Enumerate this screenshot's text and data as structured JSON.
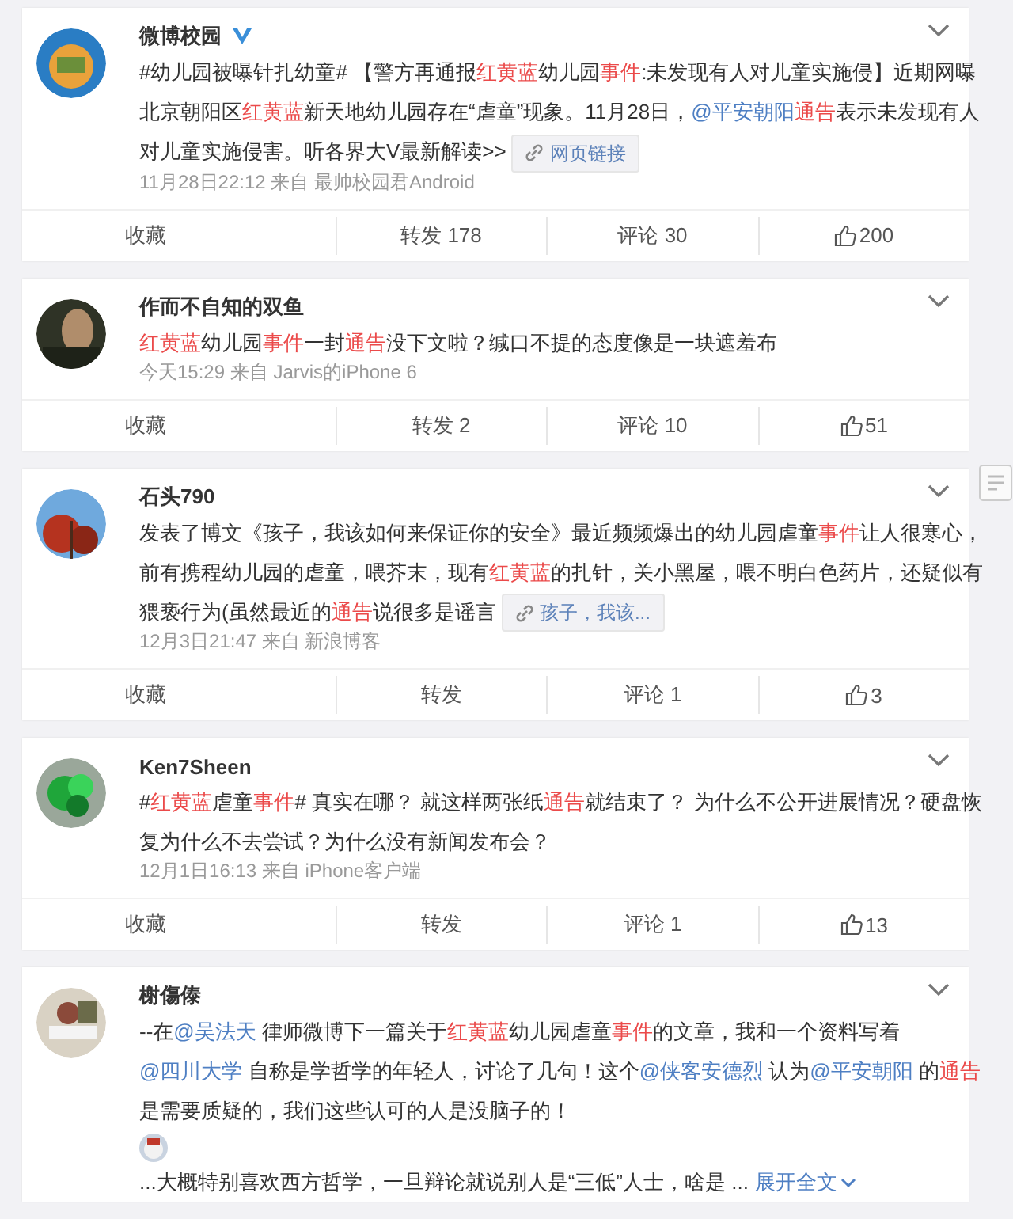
{
  "posts": [
    {
      "author": "微博校园",
      "verified": true,
      "body": [
        {
          "kind": "plain",
          "text": "#幼儿园被曝针扎幼童# 【警方再通报"
        },
        {
          "kind": "keyword",
          "text": "红黄蓝"
        },
        {
          "kind": "plain",
          "text": "幼儿园"
        },
        {
          "kind": "keyword",
          "text": "事件"
        },
        {
          "kind": "plain",
          "text": ":未发现有人对儿童实施侵】近期网曝北京朝阳区"
        },
        {
          "kind": "keyword",
          "text": "红黄蓝"
        },
        {
          "kind": "plain",
          "text": "新天地幼儿园存在“虐童”现象。11月28日，"
        },
        {
          "kind": "mention",
          "text": "@平安朝阳"
        },
        {
          "kind": "keyword",
          "text": "通告"
        },
        {
          "kind": "plain",
          "text": "表示未发现有人对儿童实施侵害。听各界大V最新解读>>"
        }
      ],
      "link": "网页链接",
      "meta": "11月28日22:12 来自 最帅校园君Android",
      "actions": [
        "收藏",
        "转发 178",
        "评论 30",
        "200"
      ]
    },
    {
      "author": "作而不自知的双鱼",
      "body": [
        {
          "kind": "keyword",
          "text": "红黄蓝"
        },
        {
          "kind": "plain",
          "text": "幼儿园"
        },
        {
          "kind": "keyword",
          "text": "事件"
        },
        {
          "kind": "plain",
          "text": "一封"
        },
        {
          "kind": "keyword",
          "text": "通告"
        },
        {
          "kind": "plain",
          "text": "没下文啦？缄口不提的态度像是一块遮羞布"
        }
      ],
      "meta": "今天15:29 来自 Jarvis的iPhone 6",
      "actions": [
        "收藏",
        "转发 2",
        "评论 10",
        "51"
      ]
    },
    {
      "author": "石头790",
      "body": [
        {
          "kind": "plain",
          "text": "发表了博文《孩子，我该如何来保证你的安全》最近频频爆出的幼儿园虐童"
        },
        {
          "kind": "keyword",
          "text": "事件"
        },
        {
          "kind": "plain",
          "text": "让人很寒心，前有携程幼儿园的虐童，喂芥末，现有"
        },
        {
          "kind": "keyword",
          "text": "红黄蓝"
        },
        {
          "kind": "plain",
          "text": "的扎针，关小黑屋，喂不明白色药片，还疑似有猥亵行为(虽然最近的"
        },
        {
          "kind": "keyword",
          "text": "通告"
        },
        {
          "kind": "plain",
          "text": "说很多是谣言"
        }
      ],
      "link": "孩子，我该...",
      "meta": "12月3日21:47 来自 新浪博客",
      "actions": [
        "收藏",
        "转发",
        "评论 1",
        "3"
      ]
    },
    {
      "author": "Ken7Sheen",
      "body": [
        {
          "kind": "plain",
          "text": "#"
        },
        {
          "kind": "keyword",
          "text": "红黄蓝"
        },
        {
          "kind": "plain",
          "text": "虐童"
        },
        {
          "kind": "keyword",
          "text": "事件"
        },
        {
          "kind": "plain",
          "text": "# 真实在哪？ 就这样两张纸"
        },
        {
          "kind": "keyword",
          "text": "通告"
        },
        {
          "kind": "plain",
          "text": "就结束了？ 为什么不公开进展情况？硬盘恢复为什么不去尝试？为什么没有新闻发布会？"
        }
      ],
      "meta": "12月1日16:13 来自 iPhone客户端",
      "actions": [
        "收藏",
        "转发",
        "评论 1",
        "13"
      ]
    },
    {
      "author": "榭傷傣",
      "body": [
        {
          "kind": "plain",
          "text": "--在"
        },
        {
          "kind": "mention",
          "text": "@吴法天"
        },
        {
          "kind": "plain",
          "text": " 律师微博下一篇关于"
        },
        {
          "kind": "keyword",
          "text": "红黄蓝"
        },
        {
          "kind": "plain",
          "text": "幼儿园虐童"
        },
        {
          "kind": "keyword",
          "text": "事件"
        },
        {
          "kind": "plain",
          "text": "的文章，我和一个资料写着"
        },
        {
          "kind": "mention",
          "text": "@四川大学"
        },
        {
          "kind": "plain",
          "text": " 自称是学哲学的年轻人，讨论了几句！这个"
        },
        {
          "kind": "mention",
          "text": "@侠客安德烈"
        },
        {
          "kind": "plain",
          "text": " 认为"
        },
        {
          "kind": "mention",
          "text": "@平安朝阳"
        },
        {
          "kind": "plain",
          "text": " 的"
        },
        {
          "kind": "keyword",
          "text": "通告"
        },
        {
          "kind": "plain",
          "text": "是需要质疑的，我们这些认可的人是没脑子的！"
        }
      ],
      "sticker": true,
      "more": "...大概特别喜欢西方哲学，一旦辩论就说别人是“三低”人士，啥是 ...",
      "expand": "展开全文"
    }
  ]
}
